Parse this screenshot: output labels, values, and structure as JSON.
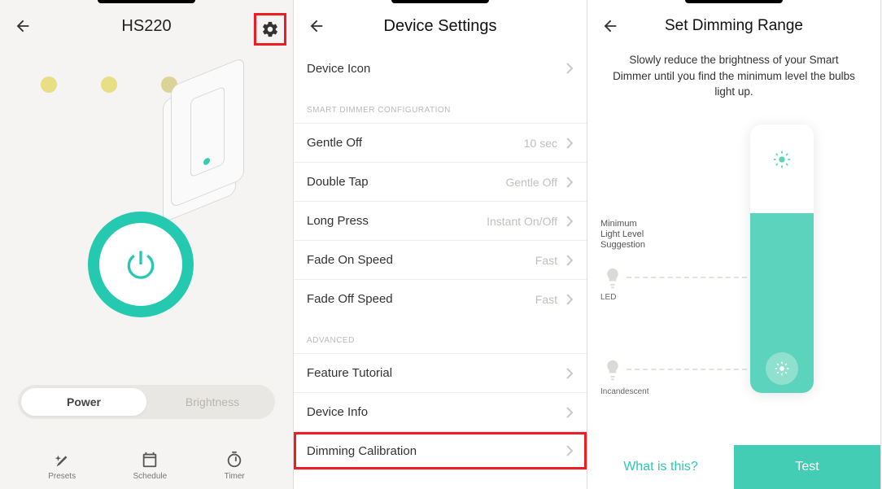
{
  "screen1": {
    "title": "HS220",
    "tabs": {
      "power": "Power",
      "brightness": "Brightness"
    },
    "bottom": {
      "presets": "Presets",
      "schedule": "Schedule",
      "timer": "Timer"
    }
  },
  "screen2": {
    "title": "Device Settings",
    "sections": {
      "top": {
        "device_icon": "Device Icon"
      },
      "dimmer_header": "SMART DIMMER CONFIGURATION",
      "dimmer": {
        "gentle_off": {
          "label": "Gentle Off",
          "value": "10 sec"
        },
        "double_tap": {
          "label": "Double Tap",
          "value": "Gentle Off"
        },
        "long_press": {
          "label": "Long Press",
          "value": "Instant On/Off"
        },
        "fade_on": {
          "label": "Fade On Speed",
          "value": "Fast"
        },
        "fade_off": {
          "label": "Fade Off Speed",
          "value": "Fast"
        }
      },
      "adv_header": "ADVANCED",
      "advanced": {
        "tutorial": "Feature Tutorial",
        "device_info": "Device Info",
        "calibration": "Dimming Calibration"
      }
    }
  },
  "screen3": {
    "title": "Set Dimming Range",
    "desc": "Slowly reduce the brightness of your Smart Dimmer until you find the minimum level the bulbs light up.",
    "suggest": "Minimum\nLight Level\nSuggestion",
    "led": "LED",
    "inc": "Incandescent",
    "what": "What is this?",
    "test": "Test"
  }
}
